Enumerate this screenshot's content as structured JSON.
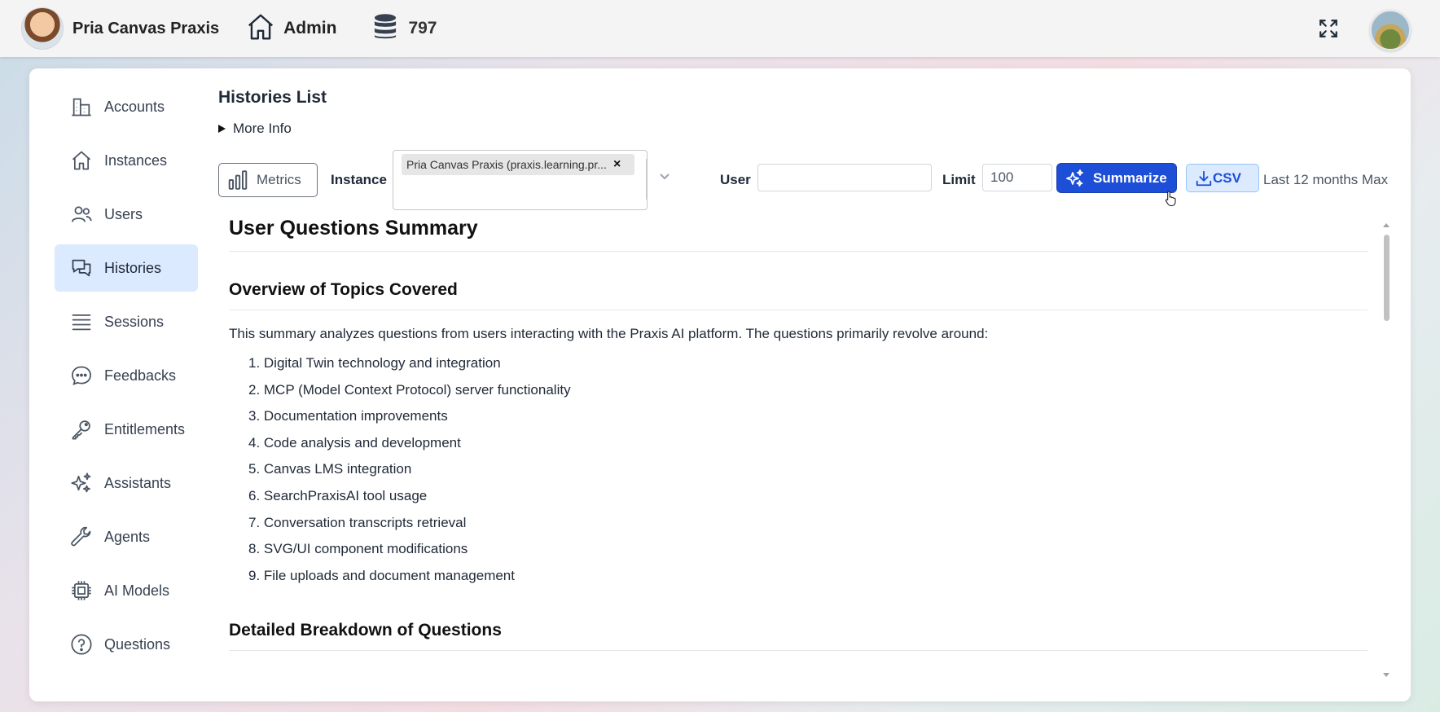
{
  "header": {
    "brand_name": "Pria Canvas Praxis",
    "admin_label": "Admin",
    "credits": "797",
    "icons": {
      "brand": "assistant-avatar",
      "admin": "home-icon",
      "credits": "database-icon",
      "fullscreen": "fullscreen-icon",
      "user": "user-avatar"
    }
  },
  "sidebar": {
    "items": [
      {
        "label": "Accounts",
        "icon": "building-icon",
        "active": false
      },
      {
        "label": "Instances",
        "icon": "home-icon",
        "active": false
      },
      {
        "label": "Users",
        "icon": "users-icon",
        "active": false
      },
      {
        "label": "Histories",
        "icon": "chat-bubbles-icon",
        "active": true
      },
      {
        "label": "Sessions",
        "icon": "list-icon",
        "active": false
      },
      {
        "label": "Feedbacks",
        "icon": "comment-dots-icon",
        "active": false
      },
      {
        "label": "Entitlements",
        "icon": "key-icon",
        "active": false
      },
      {
        "label": "Assistants",
        "icon": "sparkles-icon",
        "active": false
      },
      {
        "label": "Agents",
        "icon": "wrench-icon",
        "active": false
      },
      {
        "label": "AI Models",
        "icon": "cpu-chip-icon",
        "active": false
      },
      {
        "label": "Questions",
        "icon": "question-circle-icon",
        "active": false
      }
    ]
  },
  "main": {
    "title": "Histories List",
    "more_info": "More Info",
    "toolbar": {
      "metrics_label": "Metrics",
      "instance_label": "Instance",
      "instance_value": "Pria Canvas Praxis (praxis.learning.pr...",
      "user_label": "User",
      "user_value": "",
      "limit_label": "Limit",
      "limit_value": "100",
      "summarize_label": "Summarize",
      "csv_label": "CSV",
      "range_text": "Last 12 months Max"
    },
    "summary": {
      "heading": "User Questions Summary",
      "overview_heading": "Overview of Topics Covered",
      "intro": "This summary analyzes questions from users interacting with the Praxis AI platform. The questions primarily revolve around:",
      "topics": [
        "1. Digital Twin technology and integration",
        "2. MCP (Model Context Protocol) server functionality",
        "3. Documentation improvements",
        "4. Code analysis and development",
        "5. Canvas LMS integration",
        "6. SearchPraxisAI tool usage",
        "7. Conversation transcripts retrieval",
        "8. SVG/UI component modifications",
        "9. File uploads and document management"
      ],
      "breakdown_heading": "Detailed Breakdown of Questions"
    }
  },
  "colors": {
    "accent": "#1d4ed8",
    "active_nav_bg": "#dbeafe",
    "csv_bg": "#dbeafe"
  }
}
